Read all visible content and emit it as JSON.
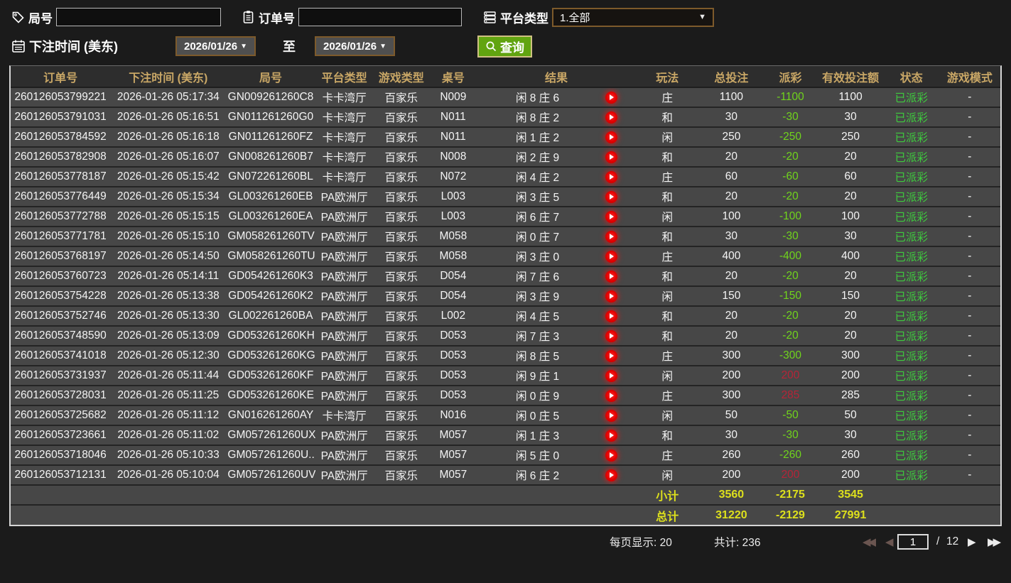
{
  "filters": {
    "game_no_label": "局号",
    "order_no_label": "订单号",
    "order_no_value": "",
    "game_no_value": "",
    "platform_label": "平台类型",
    "platform_value": "1.全部",
    "bet_time_label": "下注时间 (美东)",
    "date_from": "2026/01/26",
    "to_label": "至",
    "date_to": "2026/01/26",
    "search_label": "查询"
  },
  "table": {
    "headers": [
      "订单号",
      "下注时间 (美东)",
      "局号",
      "平台类型",
      "游戏类型",
      "桌号",
      "结果",
      "玩法",
      "总投注",
      "派彩",
      "有效投注额",
      "状态",
      "游戏模式"
    ],
    "rows": [
      {
        "order": "260126053799221",
        "time": "2026-01-26 05:17:34",
        "game": "GN009261260C8",
        "platform": "卡卡湾厅",
        "type": "百家乐",
        "table": "N009",
        "result": "闲 8 庄 6",
        "play": "庄",
        "bet": "1100",
        "payout": "-1100",
        "valid": "1100",
        "status": "已派彩",
        "mode": "-"
      },
      {
        "order": "260126053791031",
        "time": "2026-01-26 05:16:51",
        "game": "GN011261260G0",
        "platform": "卡卡湾厅",
        "type": "百家乐",
        "table": "N011",
        "result": "闲 8 庄 2",
        "play": "和",
        "bet": "30",
        "payout": "-30",
        "valid": "30",
        "status": "已派彩",
        "mode": "-"
      },
      {
        "order": "260126053784592",
        "time": "2026-01-26 05:16:18",
        "game": "GN011261260FZ",
        "platform": "卡卡湾厅",
        "type": "百家乐",
        "table": "N011",
        "result": "闲 1 庄 2",
        "play": "闲",
        "bet": "250",
        "payout": "-250",
        "valid": "250",
        "status": "已派彩",
        "mode": "-"
      },
      {
        "order": "260126053782908",
        "time": "2026-01-26 05:16:07",
        "game": "GN008261260B7",
        "platform": "卡卡湾厅",
        "type": "百家乐",
        "table": "N008",
        "result": "闲 2 庄 9",
        "play": "和",
        "bet": "20",
        "payout": "-20",
        "valid": "20",
        "status": "已派彩",
        "mode": "-"
      },
      {
        "order": "260126053778187",
        "time": "2026-01-26 05:15:42",
        "game": "GN072261260BL",
        "platform": "卡卡湾厅",
        "type": "百家乐",
        "table": "N072",
        "result": "闲 4 庄 2",
        "play": "庄",
        "bet": "60",
        "payout": "-60",
        "valid": "60",
        "status": "已派彩",
        "mode": "-"
      },
      {
        "order": "260126053776449",
        "time": "2026-01-26 05:15:34",
        "game": "GL003261260EB",
        "platform": "PA欧洲厅",
        "type": "百家乐",
        "table": "L003",
        "result": "闲 3 庄 5",
        "play": "和",
        "bet": "20",
        "payout": "-20",
        "valid": "20",
        "status": "已派彩",
        "mode": "-"
      },
      {
        "order": "260126053772788",
        "time": "2026-01-26 05:15:15",
        "game": "GL003261260EA",
        "platform": "PA欧洲厅",
        "type": "百家乐",
        "table": "L003",
        "result": "闲 6 庄 7",
        "play": "闲",
        "bet": "100",
        "payout": "-100",
        "valid": "100",
        "status": "已派彩",
        "mode": "-"
      },
      {
        "order": "260126053771781",
        "time": "2026-01-26 05:15:10",
        "game": "GM058261260TV",
        "platform": "PA欧洲厅",
        "type": "百家乐",
        "table": "M058",
        "result": "闲 0 庄 7",
        "play": "和",
        "bet": "30",
        "payout": "-30",
        "valid": "30",
        "status": "已派彩",
        "mode": "-"
      },
      {
        "order": "260126053768197",
        "time": "2026-01-26 05:14:50",
        "game": "GM058261260TU",
        "platform": "PA欧洲厅",
        "type": "百家乐",
        "table": "M058",
        "result": "闲 3 庄 0",
        "play": "庄",
        "bet": "400",
        "payout": "-400",
        "valid": "400",
        "status": "已派彩",
        "mode": "-"
      },
      {
        "order": "260126053760723",
        "time": "2026-01-26 05:14:11",
        "game": "GD054261260K3",
        "platform": "PA欧洲厅",
        "type": "百家乐",
        "table": "D054",
        "result": "闲 7 庄 6",
        "play": "和",
        "bet": "20",
        "payout": "-20",
        "valid": "20",
        "status": "已派彩",
        "mode": "-"
      },
      {
        "order": "260126053754228",
        "time": "2026-01-26 05:13:38",
        "game": "GD054261260K2",
        "platform": "PA欧洲厅",
        "type": "百家乐",
        "table": "D054",
        "result": "闲 3 庄 9",
        "play": "闲",
        "bet": "150",
        "payout": "-150",
        "valid": "150",
        "status": "已派彩",
        "mode": "-"
      },
      {
        "order": "260126053752746",
        "time": "2026-01-26 05:13:30",
        "game": "GL002261260BA",
        "platform": "PA欧洲厅",
        "type": "百家乐",
        "table": "L002",
        "result": "闲 4 庄 5",
        "play": "和",
        "bet": "20",
        "payout": "-20",
        "valid": "20",
        "status": "已派彩",
        "mode": "-"
      },
      {
        "order": "260126053748590",
        "time": "2026-01-26 05:13:09",
        "game": "GD053261260KH",
        "platform": "PA欧洲厅",
        "type": "百家乐",
        "table": "D053",
        "result": "闲 7 庄 3",
        "play": "和",
        "bet": "20",
        "payout": "-20",
        "valid": "20",
        "status": "已派彩",
        "mode": "-"
      },
      {
        "order": "260126053741018",
        "time": "2026-01-26 05:12:30",
        "game": "GD053261260KG",
        "platform": "PA欧洲厅",
        "type": "百家乐",
        "table": "D053",
        "result": "闲 8 庄 5",
        "play": "庄",
        "bet": "300",
        "payout": "-300",
        "valid": "300",
        "status": "已派彩",
        "mode": "-"
      },
      {
        "order": "260126053731937",
        "time": "2026-01-26 05:11:44",
        "game": "GD053261260KF",
        "platform": "PA欧洲厅",
        "type": "百家乐",
        "table": "D053",
        "result": "闲 9 庄 1",
        "play": "闲",
        "bet": "200",
        "payout": "200",
        "valid": "200",
        "status": "已派彩",
        "mode": "-"
      },
      {
        "order": "260126053728031",
        "time": "2026-01-26 05:11:25",
        "game": "GD053261260KE",
        "platform": "PA欧洲厅",
        "type": "百家乐",
        "table": "D053",
        "result": "闲 0 庄 9",
        "play": "庄",
        "bet": "300",
        "payout": "285",
        "valid": "285",
        "status": "已派彩",
        "mode": "-"
      },
      {
        "order": "260126053725682",
        "time": "2026-01-26 05:11:12",
        "game": "GN016261260AY",
        "platform": "卡卡湾厅",
        "type": "百家乐",
        "table": "N016",
        "result": "闲 0 庄 5",
        "play": "闲",
        "bet": "50",
        "payout": "-50",
        "valid": "50",
        "status": "已派彩",
        "mode": "-"
      },
      {
        "order": "260126053723661",
        "time": "2026-01-26 05:11:02",
        "game": "GM057261260UX",
        "platform": "PA欧洲厅",
        "type": "百家乐",
        "table": "M057",
        "result": "闲 1 庄 3",
        "play": "和",
        "bet": "30",
        "payout": "-30",
        "valid": "30",
        "status": "已派彩",
        "mode": "-"
      },
      {
        "order": "260126053718046",
        "time": "2026-01-26 05:10:33",
        "game": "GM057261260U...",
        "platform": "PA欧洲厅",
        "type": "百家乐",
        "table": "M057",
        "result": "闲 5 庄 0",
        "play": "庄",
        "bet": "260",
        "payout": "-260",
        "valid": "260",
        "status": "已派彩",
        "mode": "-"
      },
      {
        "order": "260126053712131",
        "time": "2026-01-26 05:10:04",
        "game": "GM057261260UV",
        "platform": "PA欧洲厅",
        "type": "百家乐",
        "table": "M057",
        "result": "闲 6 庄 2",
        "play": "闲",
        "bet": "200",
        "payout": "200",
        "valid": "200",
        "status": "已派彩",
        "mode": "-"
      }
    ],
    "subtotal": {
      "label": "小计",
      "bet": "3560",
      "payout": "-2175",
      "valid": "3545"
    },
    "total": {
      "label": "总计",
      "bet": "31220",
      "payout": "-2129",
      "valid": "27991"
    }
  },
  "pagination": {
    "per_page_label": "每页显示: 20",
    "total_label": "共计: 236",
    "page": "1",
    "page_sep": "/",
    "total_pages": "12"
  },
  "icons": {
    "game_no": "tag-icon",
    "order_no": "clipboard-icon",
    "platform": "server-list-icon",
    "bet_time": "calendar-icon",
    "search": "magnifier-icon",
    "result_row": "play-icon"
  },
  "colors": {
    "header_gold": "#c9a766",
    "status_paid_green": "#3ecb3e",
    "payout_lose_green": "#70d41c",
    "payout_win_red": "#b52438",
    "summary_yellow": "#dde01c",
    "search_button_green": "#61a410",
    "picker_border_brown": "#7d5a2b",
    "row_background": "#474747",
    "page_background": "#1b1b1b"
  }
}
